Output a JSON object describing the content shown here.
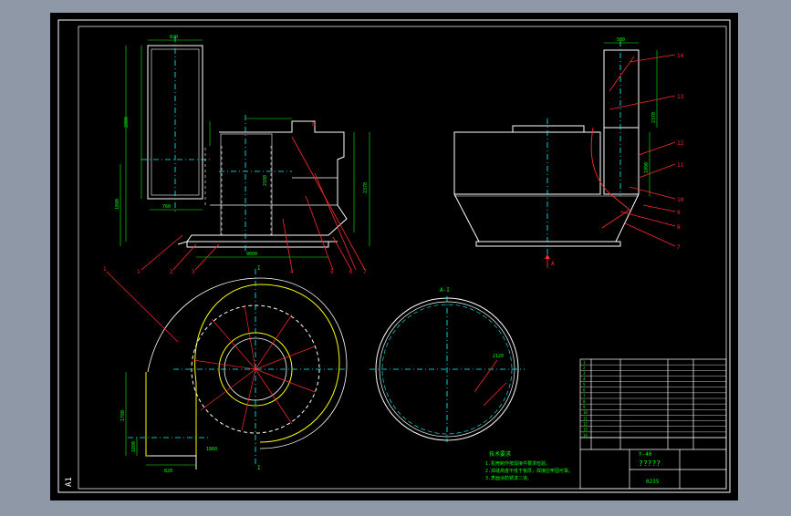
{
  "canvas": {
    "background": "#8e98a6",
    "sheet_color": "#000000",
    "border_color": "#ffffff",
    "line_color": "#ffffff",
    "dim_color": "#00ff00",
    "center_color": "#00ffff",
    "red_color": "#ff2a2a",
    "yellow_color": "#ffff00"
  },
  "sheet": {
    "size_label": "A1"
  },
  "views": {
    "front_left": {
      "callouts": [
        "1",
        "2",
        "3",
        "4",
        "5",
        "6",
        "7",
        "8"
      ],
      "dims": [
        "820",
        "2800",
        "1880",
        "2370",
        "2180",
        "9000",
        "760"
      ]
    },
    "side_right": {
      "callouts": [
        "14",
        "13",
        "12",
        "11",
        "10",
        "9",
        "8",
        "7"
      ],
      "dims": [
        "580",
        "2370",
        "1090",
        "A"
      ],
      "arrow_label": "A"
    },
    "plan_bottom": {
      "axis_labels": [
        "I",
        "I"
      ],
      "dims": [
        "1780",
        "820",
        "1860",
        "1880"
      ]
    },
    "detail_circle": {
      "title": "A-I",
      "dims": [
        "2120"
      ]
    }
  },
  "notes": {
    "title": "技术要求",
    "lines": [
      "1.机壳制作按焊接件要求检验。",
      "2.焊缝高度不低于板厚，焊接应牢固可靠。",
      "3.表面涂防锈漆二道。"
    ]
  },
  "title_block": {
    "drawing_no": "Y-40",
    "project_name": "?????",
    "scale_code": "0235",
    "part_rows": [
      "1",
      "2",
      "3",
      "4",
      "5",
      "6",
      "7",
      "8",
      "9",
      "10",
      "11",
      "12",
      "13",
      "14"
    ]
  }
}
